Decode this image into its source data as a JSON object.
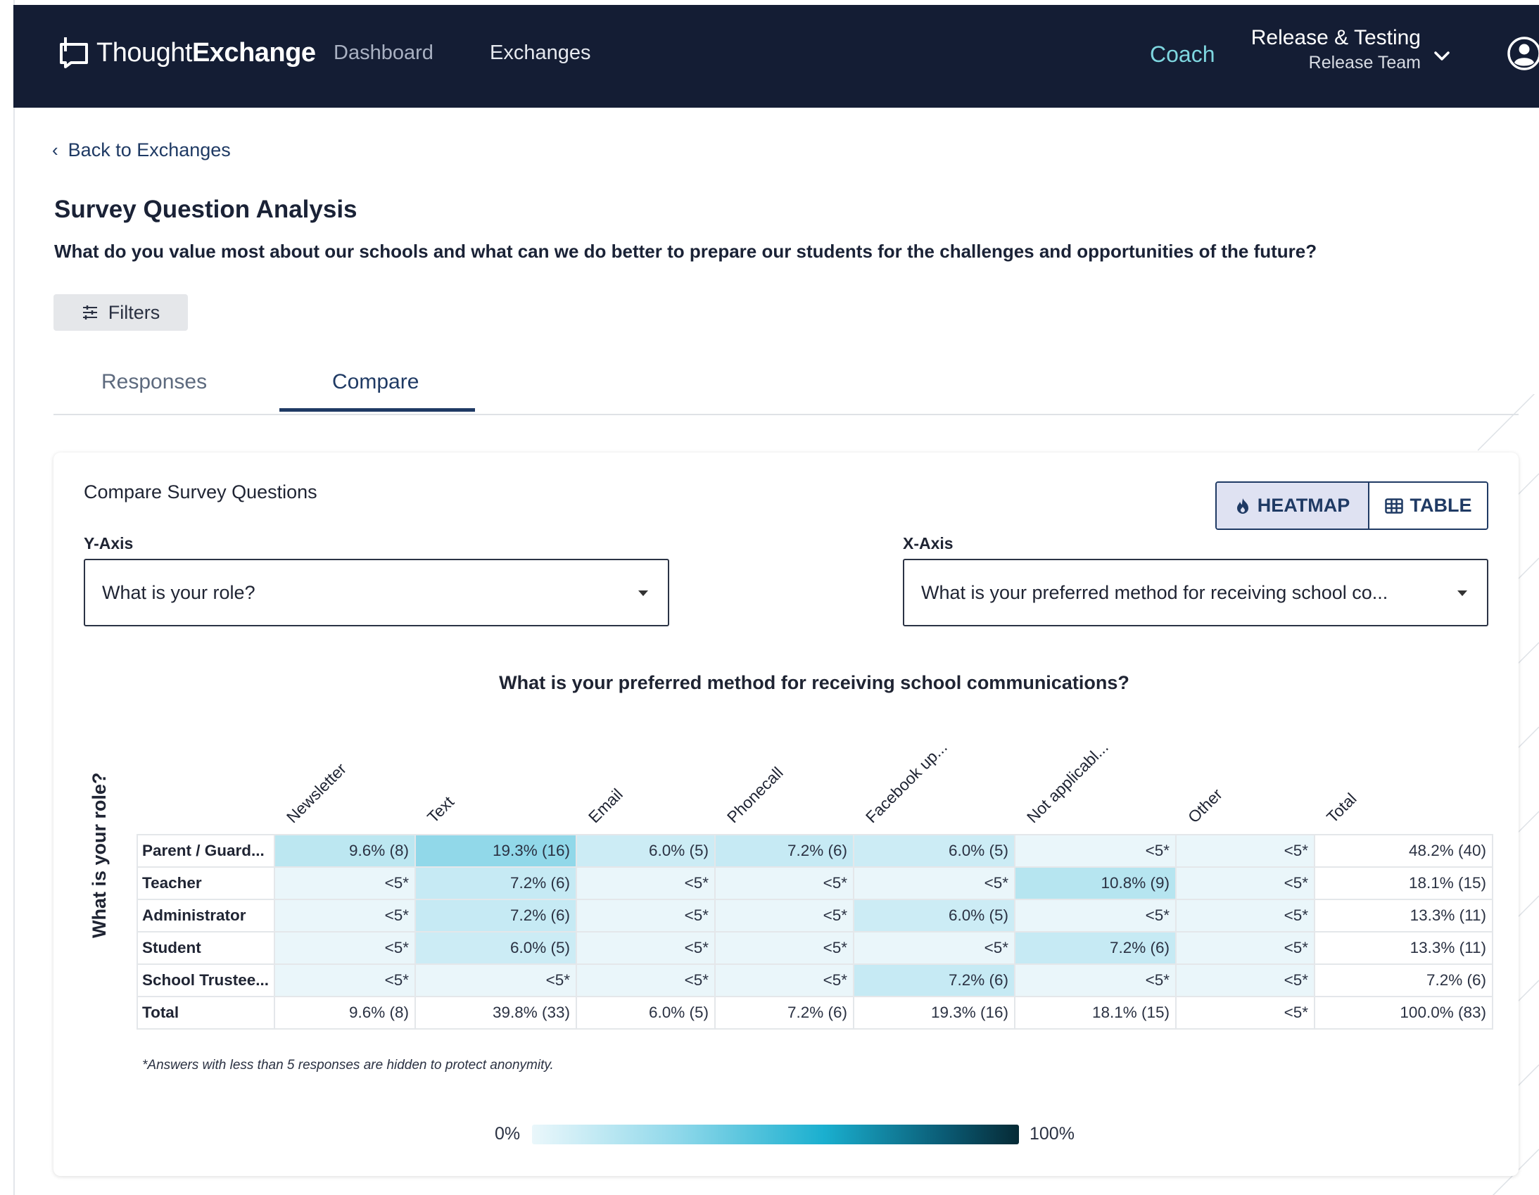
{
  "header": {
    "brand_light": "Thought",
    "brand_bold": "Exchange",
    "nav": {
      "dashboard": "Dashboard",
      "exchanges": "Exchanges"
    },
    "coach": "Coach",
    "org_name": "Release & Testing",
    "team": "Release Team"
  },
  "page": {
    "back": "Back to Exchanges",
    "title": "Survey Question Analysis",
    "question": "What do you value most about our schools and what can we do better to prepare our students for the challenges and opportunities of the future?",
    "filters": "Filters",
    "tabs": {
      "responses": "Responses",
      "compare": "Compare"
    },
    "active_tab": "Compare"
  },
  "card": {
    "title": "Compare Survey Questions",
    "toggle": {
      "heatmap": "HEATMAP",
      "table": "TABLE",
      "active": "HEATMAP"
    },
    "y_axis_label": "Y-Axis",
    "y_axis_value": "What is your role?",
    "x_axis_label": "X-Axis",
    "x_axis_value": "What is your preferred method for receiving school co..."
  },
  "heatmap": {
    "title": "What is your preferred method for receiving school communications?",
    "y_title": "What is your role?",
    "columns": [
      "Newsletter",
      "Text",
      "Email",
      "Phonecall",
      "Facebook up...",
      "Not applicabl...",
      "Other",
      "Total"
    ],
    "rows": [
      {
        "label": "Parent / Guard...",
        "cells": [
          "9.6% (8)",
          "19.3% (16)",
          "6.0% (5)",
          "7.2% (6)",
          "6.0% (5)",
          "<5*",
          "<5*",
          "48.2% (40)"
        ],
        "pct": [
          9.6,
          19.3,
          6.0,
          7.2,
          6.0,
          0,
          0,
          null
        ]
      },
      {
        "label": "Teacher",
        "cells": [
          "<5*",
          "7.2% (6)",
          "<5*",
          "<5*",
          "<5*",
          "10.8% (9)",
          "<5*",
          "18.1% (15)"
        ],
        "pct": [
          0,
          7.2,
          0,
          0,
          0,
          10.8,
          0,
          null
        ]
      },
      {
        "label": "Administrator",
        "cells": [
          "<5*",
          "7.2% (6)",
          "<5*",
          "<5*",
          "6.0% (5)",
          "<5*",
          "<5*",
          "13.3% (11)"
        ],
        "pct": [
          0,
          7.2,
          0,
          0,
          6.0,
          0,
          0,
          null
        ]
      },
      {
        "label": "Student",
        "cells": [
          "<5*",
          "6.0% (5)",
          "<5*",
          "<5*",
          "<5*",
          "7.2% (6)",
          "<5*",
          "13.3% (11)"
        ],
        "pct": [
          0,
          6.0,
          0,
          0,
          0,
          7.2,
          0,
          null
        ]
      },
      {
        "label": "School Trustee...",
        "cells": [
          "<5*",
          "<5*",
          "<5*",
          "<5*",
          "7.2% (6)",
          "<5*",
          "<5*",
          "7.2% (6)"
        ],
        "pct": [
          0,
          0,
          0,
          0,
          7.2,
          0,
          0,
          null
        ]
      }
    ],
    "total_row": {
      "label": "Total",
      "cells": [
        "9.6% (8)",
        "39.8% (33)",
        "6.0% (5)",
        "7.2% (6)",
        "19.3% (16)",
        "18.1% (15)",
        "<5*",
        "100.0% (83)"
      ]
    },
    "footnote": "*Answers with less than 5 responses are hidden to protect anonymity.",
    "legend_low": "0%",
    "legend_high": "100%",
    "colors": {
      "empty": "#eaf6fa",
      "scale_low": "#e6f5fa",
      "scale_high": "#8ed7e8"
    }
  }
}
